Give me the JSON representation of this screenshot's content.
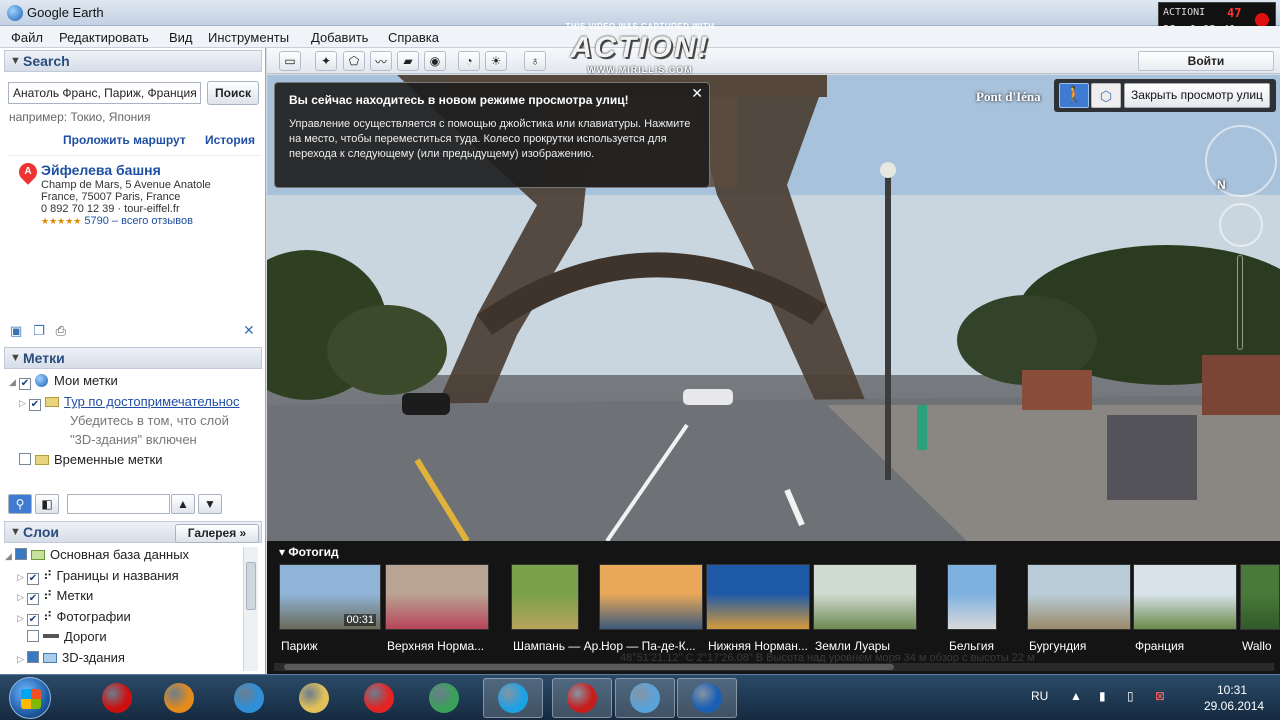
{
  "window": {
    "title": "Google Earth"
  },
  "recorder": {
    "line1": "ACTIONI",
    "fps": "47",
    "line2a": "22",
    "line2b": "0:02:41"
  },
  "watermark": {
    "top": "THIS VIDEO WAS CAPTURED WITH",
    "logo": "ACTION!",
    "url": "WWW.MIRILLIS.COM"
  },
  "menu": [
    "Файл",
    "Редактировать",
    "Вид",
    "Инструменты",
    "Добавить",
    "Справка"
  ],
  "toolbar": {
    "signin": "Войти"
  },
  "search": {
    "header": "Search",
    "input_value": "Анатоль Франс, Париж, Франция",
    "button": "Поиск",
    "hint": "например: Токио, Япония",
    "route_link": "Проложить маршрут",
    "history_link": "История",
    "result": {
      "marker": "A",
      "title": "Эйфелева башня",
      "address_lines": [
        "Champ de Mars, 5 Avenue Anatole",
        "France, 75007 Paris, France",
        "0 892 70 12 39 · tour-eiffel.fr"
      ],
      "stars": "★★★★★",
      "reviews": "5790 – всего отзывов"
    }
  },
  "places": {
    "header": "Метки",
    "my_places": "Мои метки",
    "tour": "Тур по достопримечательнос",
    "note1": "Убедитесь в том, что слой",
    "note2": "\"3D-здания\" включен",
    "temp": "Временные метки"
  },
  "layers": {
    "header": "Слои",
    "gallery": "Галерея »",
    "items": [
      "Основная база данных",
      "Границы и названия",
      "Метки",
      "Фотографии",
      "Дороги",
      "3D-здания"
    ]
  },
  "streetview": {
    "tip_title": "Вы сейчас находитесь в новом режиме просмотра улиц!",
    "tip_body": "Управление осуществляется с помощью джойстика или клавиатуры. Нажмите на место, чтобы переместиться туда. Колесо прокрутки используется для перехода к следующему (или предыдущему) изображению.",
    "location": "Pont d'Iéna",
    "exit": "Закрыть просмотр улиц"
  },
  "photos": {
    "header": "Фотогид",
    "items": [
      {
        "caption": "Париж",
        "duration": "00:31",
        "c1": "#8fb4d8",
        "c2": "#6a6a58"
      },
      {
        "caption": "Верхняя Норма...",
        "c1": "#b9a392",
        "c2": "#b7445a"
      },
      {
        "caption": "Шампань — Ар...",
        "c1": "#7aa24a",
        "c2": "#b8a35a"
      },
      {
        "caption": "Нор — Па-де-К...",
        "c1": "#e9a85a",
        "c2": "#3d5a7a"
      },
      {
        "caption": "Нижняя Норман...",
        "c1": "#1f5aa8",
        "c2": "#d49a3a"
      },
      {
        "caption": "Земли Луары",
        "c1": "#cfdad0",
        "c2": "#6e8a52"
      },
      {
        "caption": "Бельгия",
        "c1": "#7fb1e0",
        "c2": "#d9d9d9"
      },
      {
        "caption": "Бургундия",
        "c1": "#b9ccd8",
        "c2": "#9a8a6a"
      },
      {
        "caption": "Франция",
        "c1": "#d8e2ea",
        "c2": "#6a8a4a"
      },
      {
        "caption": "Wallo",
        "c1": "#4a7a3a",
        "c2": "#2f5a2a"
      }
    ]
  },
  "status_line": "48°51'21.12\" С    2°17'26.08\" В  Высота над уровнем моря    34 м    обзор с высоты    22 м",
  "taskbar": {
    "lang": "RU",
    "time": "10:31",
    "date": "29.06.2014",
    "apps": [
      {
        "name": "opera-app",
        "color": "#cc1010"
      },
      {
        "name": "media-player-app",
        "color": "#e38b1c"
      },
      {
        "name": "ie-app",
        "color": "#2f8fd9"
      },
      {
        "name": "explorer-app",
        "color": "#e2c15a"
      },
      {
        "name": "yandex-app",
        "color": "#e42424"
      },
      {
        "name": "chrome-app",
        "color": "#3aa05a"
      },
      {
        "name": "skype-app",
        "color": "#1da1e3"
      },
      {
        "name": "recorder-app",
        "color": "#c81d1d"
      },
      {
        "name": "monitor-app",
        "color": "#5aa2da"
      },
      {
        "name": "google-earth-app",
        "color": "#1b5fb5"
      }
    ]
  }
}
